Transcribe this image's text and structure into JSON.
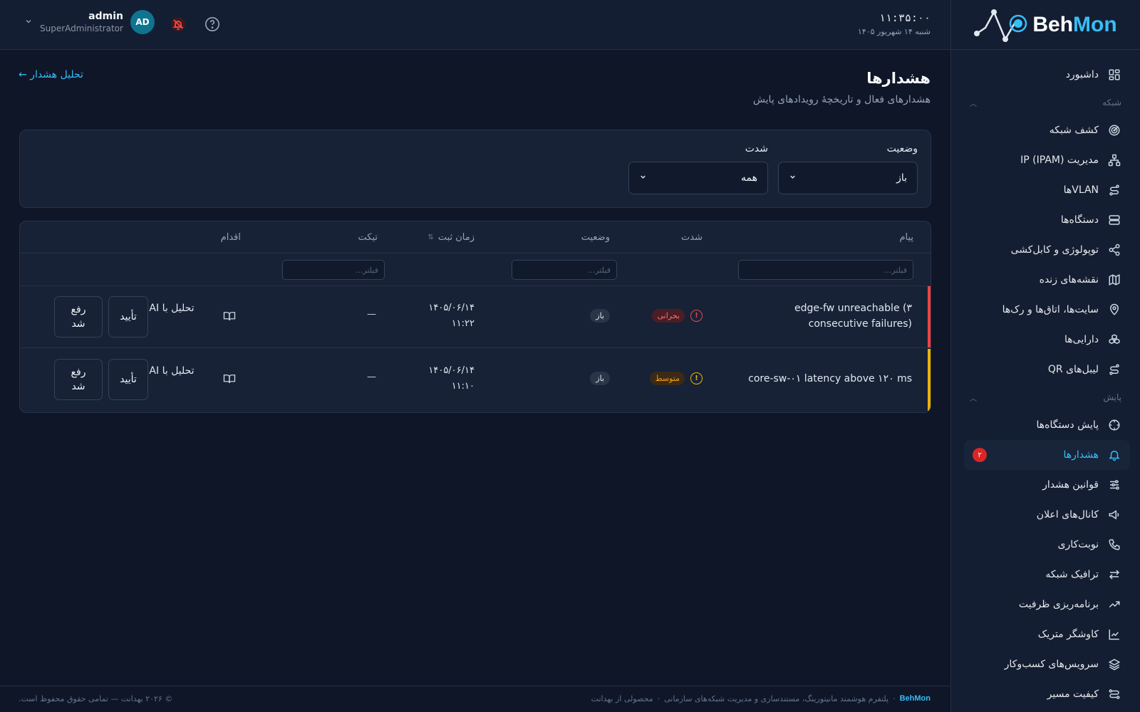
{
  "brand": {
    "part1": "Beh",
    "part2": "Mon"
  },
  "header": {
    "time": "۱۱:۳۵:۰۰",
    "date": "شنبه ۱۴ شهریور ۱۴۰۵",
    "user": {
      "name": "admin",
      "role": "SuperAdministrator",
      "initials": "AD"
    }
  },
  "sidebar": {
    "items": [
      {
        "label": "داشبورد",
        "icon": "dashboard-icon"
      },
      {
        "section": "شبکه"
      },
      {
        "label": "کشف شبکه",
        "icon": "radar-icon"
      },
      {
        "label": "مدیریت IP (IPAM)",
        "icon": "network-tree-icon"
      },
      {
        "label": "VLANها",
        "icon": "route-icon"
      },
      {
        "label": "دستگاه‌ها",
        "icon": "server-icon"
      },
      {
        "label": "توپولوژی و کابل‌کشی",
        "icon": "share-icon"
      },
      {
        "label": "نقشه‌های زنده",
        "icon": "map-icon"
      },
      {
        "label": "سایت‌ها، اتاق‌ها و رک‌ها",
        "icon": "map-pin-icon"
      },
      {
        "label": "دارایی‌ها",
        "icon": "boxes-icon"
      },
      {
        "label": "لیبل‌های QR",
        "icon": "route-icon"
      },
      {
        "section": "پایش"
      },
      {
        "label": "پایش دستگاه‌ها",
        "icon": "crosshair-icon"
      },
      {
        "label": "هشدارها",
        "icon": "bell-icon",
        "active": true,
        "badge": "۲"
      },
      {
        "label": "قوانین هشدار",
        "icon": "sliders-icon"
      },
      {
        "label": "کانال‌های اعلان",
        "icon": "megaphone-icon"
      },
      {
        "label": "نوبت‌کاری",
        "icon": "phone-icon"
      },
      {
        "label": "ترافیک شبکه",
        "icon": "arrows-icon"
      },
      {
        "label": "برنامه‌ریزی ظرفیت",
        "icon": "trend-icon"
      },
      {
        "label": "کاوشگر متریک",
        "icon": "line-chart-icon"
      },
      {
        "label": "سرویس‌های کسب‌وکار",
        "icon": "layers-icon"
      },
      {
        "label": "کیفیت مسیر",
        "icon": "path-icon"
      }
    ]
  },
  "page": {
    "title": "هشدارها",
    "subtitle": "هشدارهای فعال و تاریخچهٔ رویدادهای پایش",
    "back_link": "تحلیل هشدار ←"
  },
  "filters": {
    "status_label": "وضعیت",
    "status_value": "باز",
    "severity_label": "شدت",
    "severity_value": "همه"
  },
  "table": {
    "headers": {
      "message": "پیام",
      "severity": "شدت",
      "status": "وضعیت",
      "time": "زمان ثبت",
      "ticket": "تیکت",
      "action": "اقدام"
    },
    "filter_placeholder": "فیلتر...",
    "rows": [
      {
        "message": "edge-fw unreachable (۳ consecutive failures)",
        "severity": "بحرانی",
        "severity_color": "#ef4444",
        "status": "باز",
        "date": "۱۴۰۵/۰۶/۱۴",
        "time": "۱۱:۲۲",
        "ticket": "—",
        "ai_label": "تحلیل با AI",
        "ack_label": "تأیید",
        "resolve_label": "رفع شد"
      },
      {
        "message": "core-sw-۰۱ latency above ۱۲۰ ms",
        "severity": "متوسط",
        "severity_color": "#eab308",
        "status": "باز",
        "date": "۱۴۰۵/۰۶/۱۴",
        "time": "۱۱:۱۰",
        "ticket": "—",
        "ai_label": "تحلیل با AI",
        "ack_label": "تأیید",
        "resolve_label": "رفع شد"
      }
    ]
  },
  "footer": {
    "brand": "BehMon",
    "tagline": "پلتفرم هوشمند مانیتورینگ، مستندسازی و مدیریت شبکه‌های سازمانی",
    "product": "محصولی از بهدانت",
    "copyright": "© ۲۰۲۶ بهدانت — تمامی حقوق محفوظ است."
  }
}
